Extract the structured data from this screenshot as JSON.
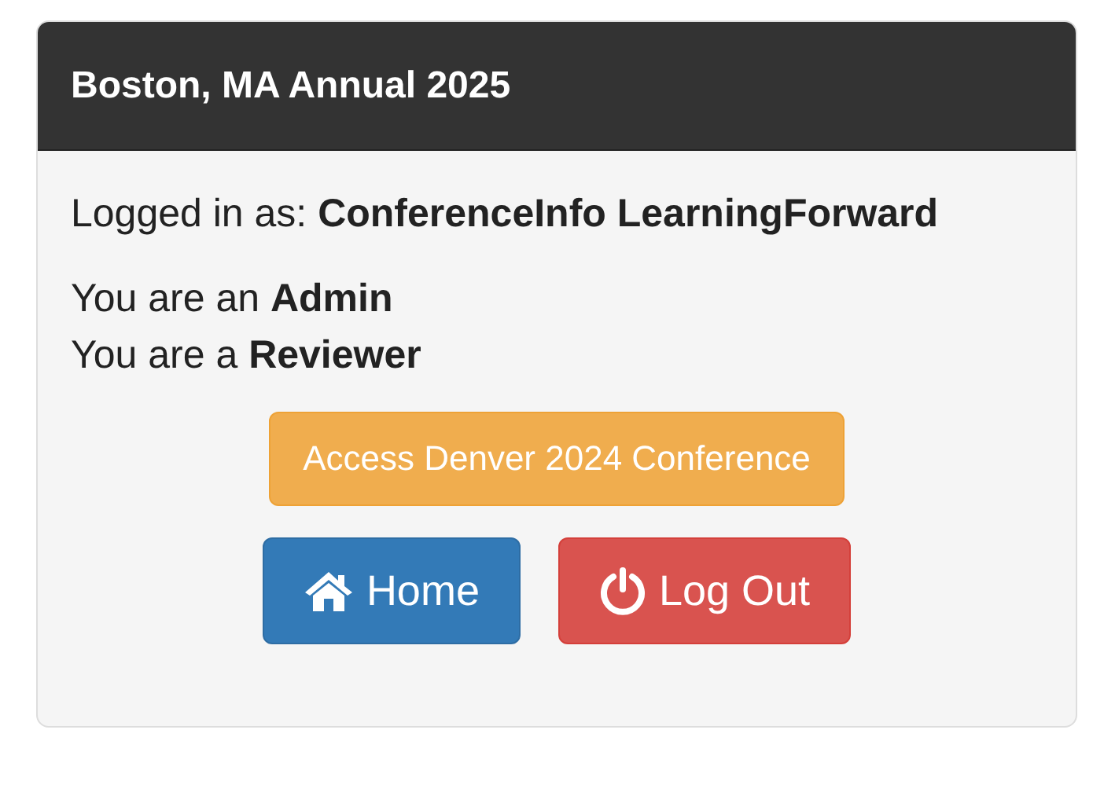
{
  "panel": {
    "title": "Boston, MA Annual 2025"
  },
  "logged_in": "Logged in as: **ConferenceInfo LearningForward**",
  "roles": [
    "You are an **Admin**",
    "You are a **Reviewer**"
  ],
  "conference_button": {
    "label": "Access Denver 2024 Conference"
  },
  "buttons": [
    {
      "kind": "home",
      "label": "Home"
    },
    {
      "kind": "logout",
      "label": "Log Out"
    }
  ]
}
